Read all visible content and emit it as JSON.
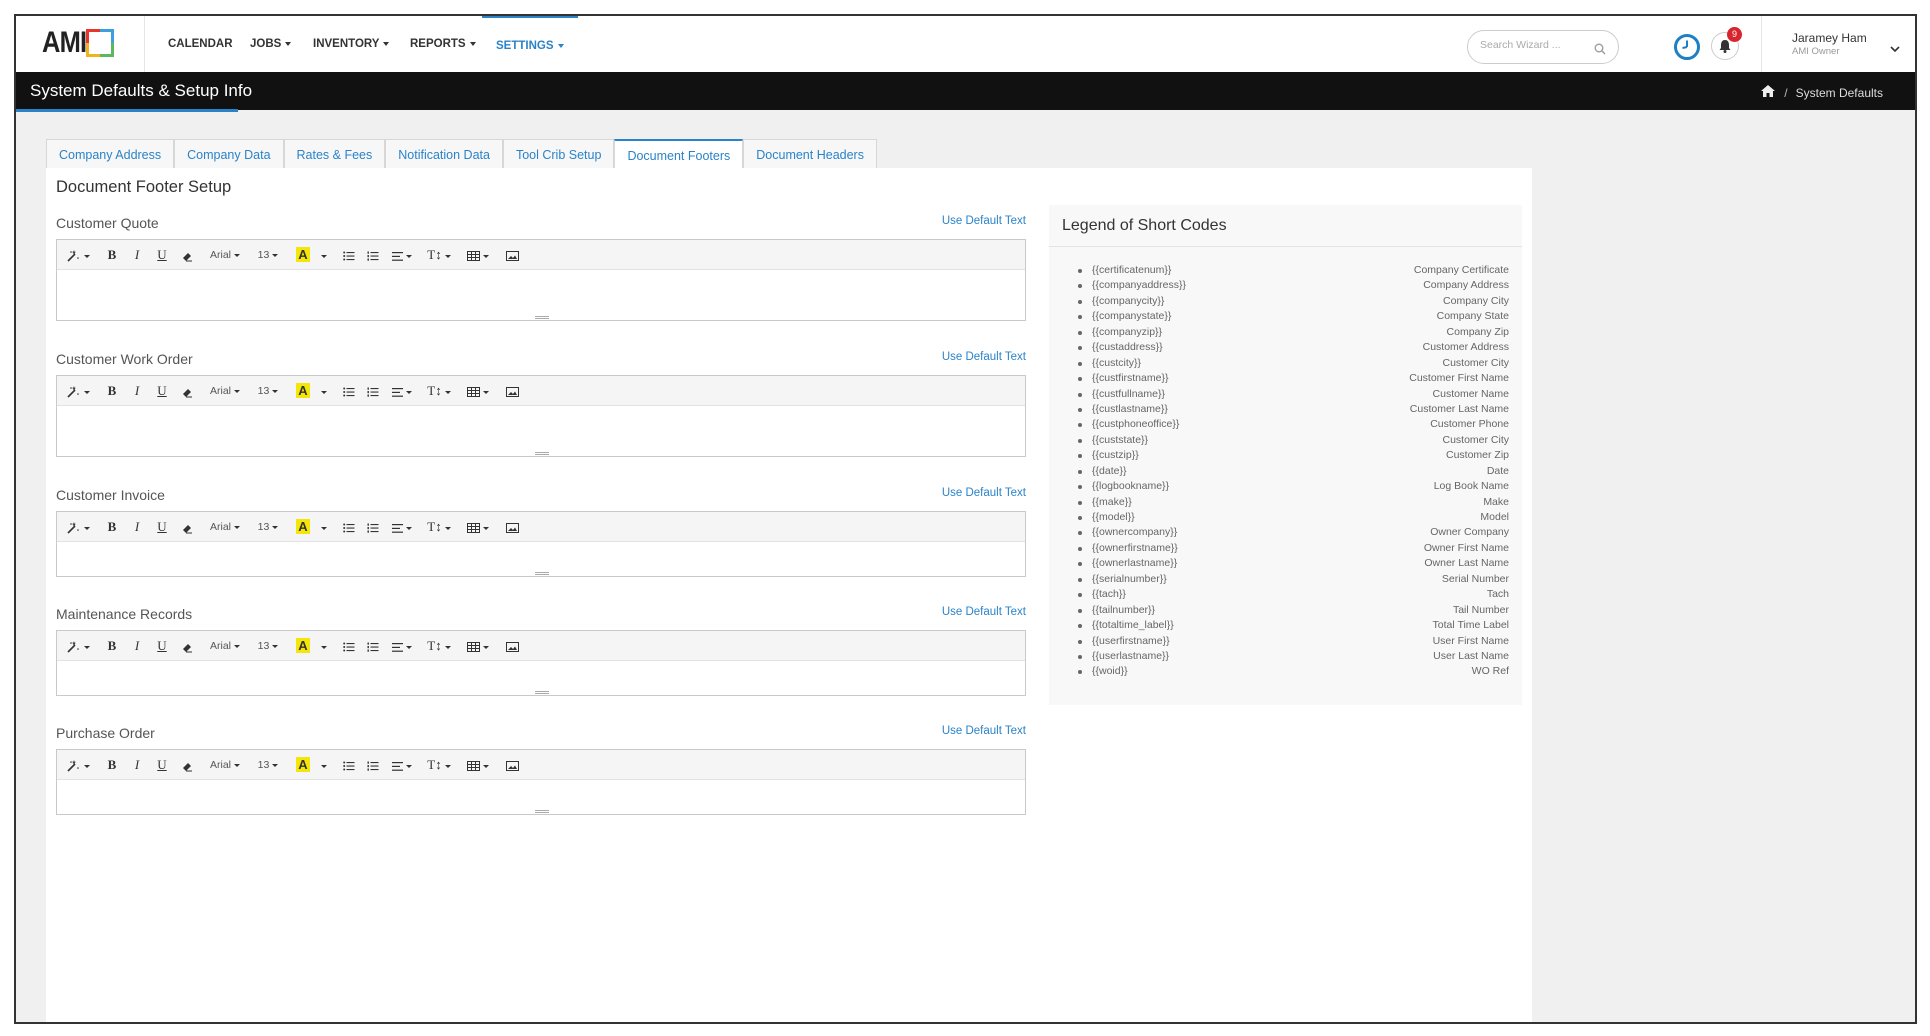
{
  "nav": {
    "logo_text": "AMI",
    "items": [
      {
        "label": "CALENDAR",
        "dropdown": false
      },
      {
        "label": "JOBS",
        "dropdown": true
      },
      {
        "label": "INVENTORY",
        "dropdown": true
      },
      {
        "label": "REPORTS",
        "dropdown": true
      },
      {
        "label": "SETTINGS",
        "dropdown": true,
        "active": true
      }
    ],
    "search_placeholder": "Search Wizard ...",
    "notification_count": "9",
    "user_name": "Jaramey Ham",
    "user_role": "AMI Owner"
  },
  "header": {
    "title": "System Defaults & Setup Info",
    "breadcrumb_current": "System Defaults",
    "breadcrumb_sep": "/"
  },
  "tabs": [
    "Company Address",
    "Company Data",
    "Rates & Fees",
    "Notification Data",
    "Tool Crib Setup",
    "Document Footers",
    "Document Headers"
  ],
  "active_tab": "Document Footers",
  "panel_title": "Document Footer Setup",
  "use_default_label": "Use Default Text",
  "sections": [
    {
      "label": "Customer Quote"
    },
    {
      "label": "Customer Work Order"
    },
    {
      "label": "Customer Invoice"
    },
    {
      "label": "Maintenance Records"
    },
    {
      "label": "Purchase Order"
    }
  ],
  "toolbar": {
    "bold": "B",
    "italic": "I",
    "underline": "U",
    "font_name": "Arial",
    "font_size": "13",
    "color": "A",
    "height": "T↕"
  },
  "legend": {
    "title": "Legend of Short Codes",
    "items": [
      {
        "code": "{{certificatenum}}",
        "desc": "Company Certificate"
      },
      {
        "code": "{{companyaddress}}",
        "desc": "Company Address"
      },
      {
        "code": "{{companycity}}",
        "desc": "Company City"
      },
      {
        "code": "{{companystate}}",
        "desc": "Company State"
      },
      {
        "code": "{{companyzip}}",
        "desc": "Company Zip"
      },
      {
        "code": "{{custaddress}}",
        "desc": "Customer Address"
      },
      {
        "code": "{{custcity}}",
        "desc": "Customer City"
      },
      {
        "code": "{{custfirstname}}",
        "desc": "Customer First Name"
      },
      {
        "code": "{{custfullname}}",
        "desc": "Customer Name"
      },
      {
        "code": "{{custlastname}}",
        "desc": "Customer Last Name"
      },
      {
        "code": "{{custphoneoffice}}",
        "desc": "Customer Phone"
      },
      {
        "code": "{{custstate}}",
        "desc": "Customer City"
      },
      {
        "code": "{{custzip}}",
        "desc": "Customer Zip"
      },
      {
        "code": "{{date}}",
        "desc": "Date"
      },
      {
        "code": "{{logbookname}}",
        "desc": "Log Book Name"
      },
      {
        "code": "{{make}}",
        "desc": "Make"
      },
      {
        "code": "{{model}}",
        "desc": "Model"
      },
      {
        "code": "{{ownercompany}}",
        "desc": "Owner Company"
      },
      {
        "code": "{{ownerfirstname}}",
        "desc": "Owner First Name"
      },
      {
        "code": "{{ownerlastname}}",
        "desc": "Owner Last Name"
      },
      {
        "code": "{{serialnumber}}",
        "desc": "Serial Number"
      },
      {
        "code": "{{tach}}",
        "desc": "Tach"
      },
      {
        "code": "{{tailnumber}}",
        "desc": "Tail Number"
      },
      {
        "code": "{{totaltime_label}}",
        "desc": "Total Time Label"
      },
      {
        "code": "{{userfirstname}}",
        "desc": "User First Name"
      },
      {
        "code": "{{userlastname}}",
        "desc": "User Last Name"
      },
      {
        "code": "{{woid}}",
        "desc": "WO Ref"
      }
    ]
  },
  "colors": {
    "accent": "#2a83c9",
    "header_bg": "#111111",
    "badge": "#d9232d",
    "highlight_yellow": "#f5e60a"
  },
  "icons": [
    "magic-wand-icon",
    "eraser-icon",
    "unordered-list-icon",
    "ordered-list-icon",
    "align-icon",
    "table-icon",
    "picture-icon",
    "search-icon",
    "clock-icon",
    "bell-icon",
    "home-icon",
    "chevron-down-icon"
  ]
}
